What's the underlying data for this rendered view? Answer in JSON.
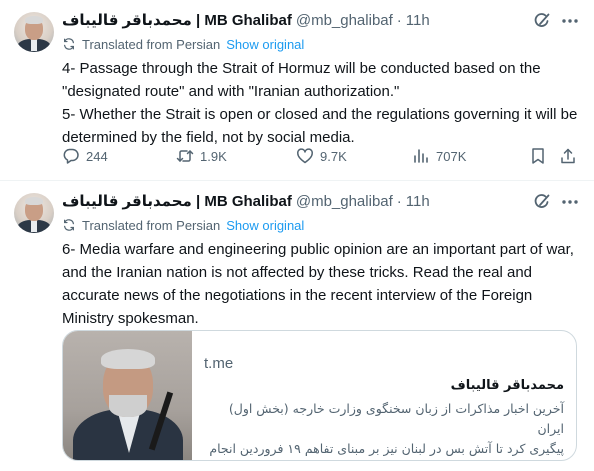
{
  "author": {
    "name": "محمدباقر قالیباف | MB Ghalibaf",
    "handle": "@mb_ghalibaf",
    "dot": "·"
  },
  "tweets": [
    {
      "time": "11h",
      "translated_label": "Translated from Persian",
      "show_original": "Show original",
      "text": "4- Passage through the Strait of Hormuz will be conducted based on the \"designated route\" and with \"Iranian authorization.\"\n5- Whether the Strait is open or closed and the regulations governing it will be determined by the field, not by social media.",
      "stats": {
        "replies": "244",
        "reposts": "1.9K",
        "likes": "9.7K",
        "views": "707K"
      }
    },
    {
      "time": "11h",
      "translated_label": "Translated from Persian",
      "show_original": "Show original",
      "text": "6- Media warfare and engineering public opinion are an important part of war, and the Iranian nation is not affected by these tricks. Read the real and accurate news of the negotiations in the recent interview of the Foreign Ministry spokesman.",
      "card": {
        "domain": "t.me",
        "title": "محمدباقر قالیباف",
        "description_line1": "آخرین اخبار مذاکرات از زبان سخنگوی وزارت خارجه (بخش اول) ایران",
        "description_line2": "پیگیری کرد تا آتش بس در لبنان نیز بر مبنای تفاهم ۱۹ فروردین انجام شو..."
      }
    }
  ],
  "icons": {
    "grok": "grok-icon",
    "more": "more-icon",
    "translate": "translate-icon",
    "reply": "reply-icon",
    "retweet": "retweet-icon",
    "like": "heart-icon",
    "views": "views-icon",
    "bookmark": "bookmark-icon",
    "share": "share-icon"
  },
  "colors": {
    "text_primary": "#0f1419",
    "text_secondary": "#536471",
    "link": "#1d9bf0",
    "border": "#cfd9de"
  }
}
